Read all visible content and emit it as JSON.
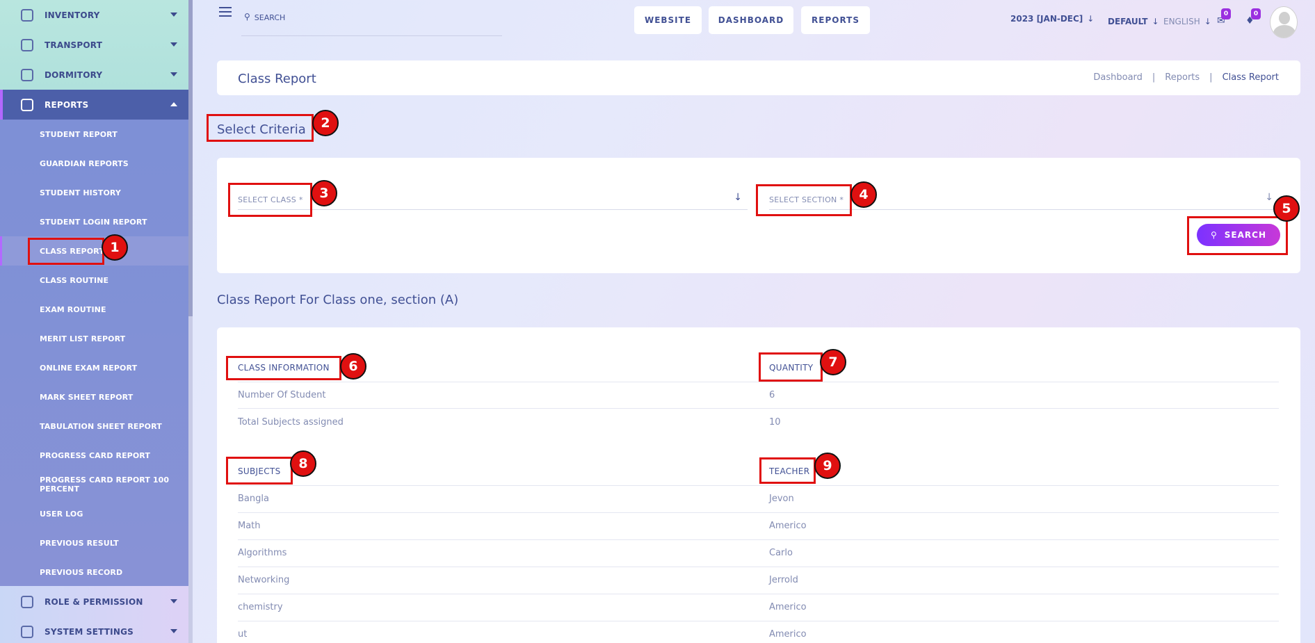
{
  "sidebar": {
    "menu_top": [
      {
        "label": "INVENTORY",
        "icon": "inventory-icon"
      },
      {
        "label": "TRANSPORT",
        "icon": "transport-icon"
      },
      {
        "label": "DORMITORY",
        "icon": "dormitory-icon"
      },
      {
        "label": "REPORTS",
        "icon": "reports-icon"
      }
    ],
    "sub_items": [
      "STUDENT REPORT",
      "GUARDIAN REPORTS",
      "STUDENT HISTORY",
      "STUDENT LOGIN REPORT",
      "CLASS REPORT",
      "CLASS ROUTINE",
      "EXAM ROUTINE",
      "MERIT LIST REPORT",
      "ONLINE EXAM REPORT",
      "MARK SHEET REPORT",
      "TABULATION SHEET REPORT",
      "PROGRESS CARD REPORT",
      "PROGRESS CARD REPORT 100 PERCENT",
      "USER LOG",
      "PREVIOUS RESULT",
      "PREVIOUS RECORD"
    ],
    "menu_bottom": [
      {
        "label": "ROLE & PERMISSION",
        "icon": "role-permission-icon"
      },
      {
        "label": "SYSTEM SETTINGS",
        "icon": "system-settings-icon"
      }
    ]
  },
  "topbar": {
    "search_placeholder": "SEARCH",
    "buttons": [
      "WEBSITE",
      "DASHBOARD",
      "REPORTS"
    ],
    "academic_year": "2023 [JAN-DEC]",
    "theme": "DEFAULT",
    "language": "ENGLISH",
    "message_count": "0",
    "notification_count": "0"
  },
  "page": {
    "title": "Class Report",
    "breadcrumb": [
      "Dashboard",
      "Reports",
      "Class Report"
    ],
    "breadcrumb_sep": "|"
  },
  "criteria": {
    "title": "Select Criteria",
    "class_label": "SELECT CLASS *",
    "section_label": "SELECT SECTION *",
    "search_label": "SEARCH"
  },
  "report": {
    "title": "Class Report For Class one, section (A)",
    "info_headers": [
      "CLASS INFORMATION",
      "QUANTITY"
    ],
    "info_rows": [
      [
        "Number Of Student",
        "6"
      ],
      [
        "Total Subjects assigned",
        "10"
      ]
    ],
    "subject_headers": [
      "SUBJECTS",
      "TEACHER"
    ],
    "subject_rows": [
      [
        "Bangla",
        "Jevon"
      ],
      [
        "Math",
        "Americo"
      ],
      [
        "Algorithms",
        "Carlo"
      ],
      [
        "Networking",
        "Jerrold"
      ],
      [
        "chemistry",
        "Americo"
      ],
      [
        "ut",
        "Americo"
      ]
    ]
  },
  "annotations": [
    "1",
    "2",
    "3",
    "4",
    "5",
    "6",
    "7",
    "8",
    "9"
  ],
  "colors": {
    "accent": "#7c32ff",
    "annotation_red": "#e01010",
    "sidebar_active": "#4c5fa9",
    "text_primary": "#415094"
  }
}
